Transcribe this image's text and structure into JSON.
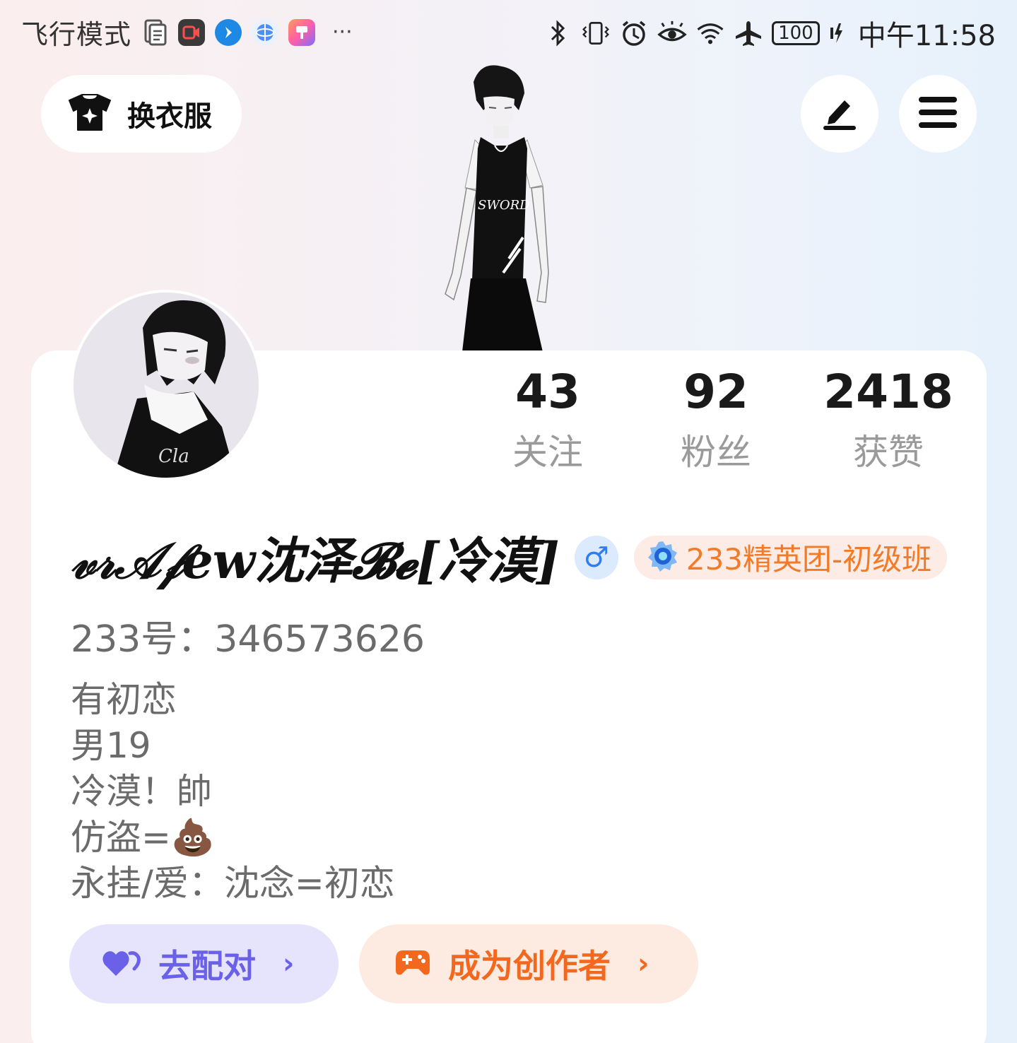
{
  "status_bar": {
    "mode": "飞行模式",
    "more": "···",
    "battery": "100",
    "time": "中午11:58",
    "app_icons": [
      "document-icon",
      "screen-record-icon",
      "messenger-icon",
      "browser-icon",
      "paint-app-icon"
    ],
    "system_icons": [
      "bluetooth-icon",
      "vibrate-icon",
      "alarm-icon",
      "eye-comfort-icon",
      "wifi-icon",
      "airplane-icon",
      "charging-icon"
    ]
  },
  "header": {
    "outfit_label": "换衣服",
    "outfit_icon": "tshirt-icon",
    "edit_icon": "edit-icon",
    "menu_icon": "menu-icon"
  },
  "stats": [
    {
      "value": "43",
      "label": "关注"
    },
    {
      "value": "92",
      "label": "粉丝"
    },
    {
      "value": "2418",
      "label": "获赞"
    }
  ],
  "profile": {
    "username": "𝓋𝓇𝒜𝒻ew沈泽𝓑𝓮[冷漠]",
    "gender_symbol": "♂",
    "badge_text": "233精英团-初级班",
    "uid": "233号：346573626",
    "bio": [
      "有初恋",
      "男19",
      "冷漠！帥",
      "仿盗=💩",
      "永挂/爱：沈念=初恋"
    ]
  },
  "actions": {
    "match_label": "去配对",
    "creator_label": "成为创作者",
    "chevron": "›"
  },
  "colors": {
    "match_accent": "#6b61e8",
    "creator_accent": "#f2681f",
    "badge_text": "#f27b2a",
    "gender_blue": "#2f7df0"
  }
}
